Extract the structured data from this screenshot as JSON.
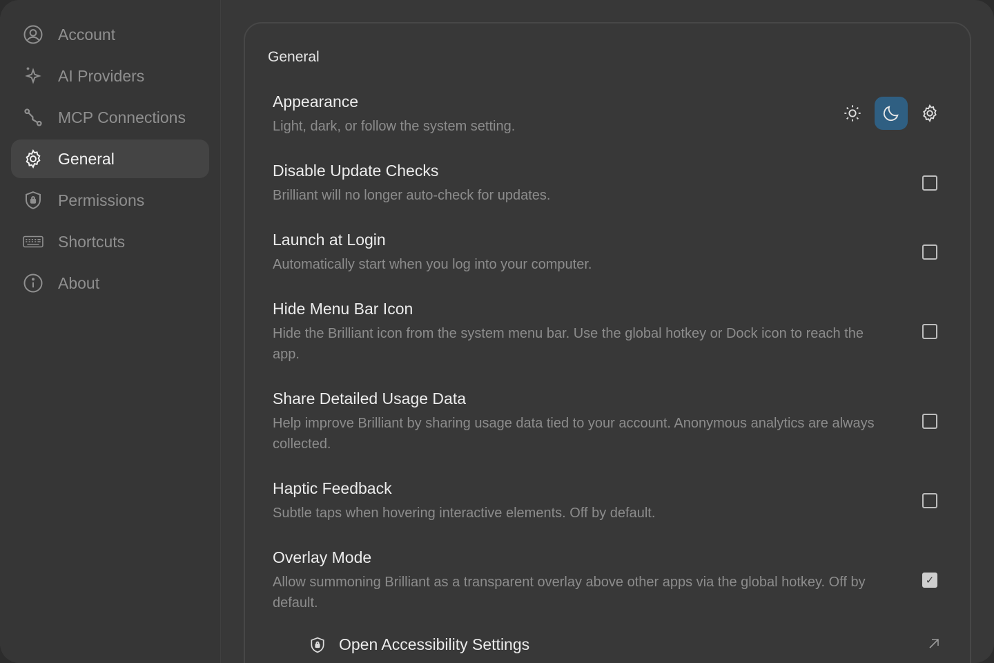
{
  "sidebar": {
    "items": [
      {
        "label": "Account",
        "icon": "account-icon"
      },
      {
        "label": "AI Providers",
        "icon": "sparkle-icon"
      },
      {
        "label": "MCP Connections",
        "icon": "connection-icon"
      },
      {
        "label": "General",
        "icon": "gear-icon",
        "active": true
      },
      {
        "label": "Permissions",
        "icon": "shield-icon"
      },
      {
        "label": "Shortcuts",
        "icon": "keyboard-icon"
      },
      {
        "label": "About",
        "icon": "info-icon"
      }
    ]
  },
  "main": {
    "section_title": "General",
    "appearance": {
      "title": "Appearance",
      "description": "Light, dark, or follow the system setting.",
      "options": [
        "light",
        "dark",
        "system"
      ],
      "selected": "dark",
      "accent": "#2f5f82"
    },
    "settings": [
      {
        "title": "Disable Update Checks",
        "description": "Brilliant will no longer auto-check for updates.",
        "checked": false
      },
      {
        "title": "Launch at Login",
        "description": "Automatically start when you log into your computer.",
        "checked": false
      },
      {
        "title": "Hide Menu Bar Icon",
        "description": "Hide the Brilliant icon from the system menu bar. Use the global hotkey or Dock icon to reach the app.",
        "checked": false
      },
      {
        "title": "Share Detailed Usage Data",
        "description": "Help improve Brilliant by sharing usage data tied to your account. Anonymous analytics are always collected.",
        "checked": false
      },
      {
        "title": "Haptic Feedback",
        "description": "Subtle taps when hovering interactive elements. Off by default.",
        "checked": false
      },
      {
        "title": "Overlay Mode",
        "description": "Allow summoning Brilliant as a transparent overlay above other apps via the global hotkey. Off by default.",
        "checked": true
      }
    ],
    "accessibility_link": "Open Accessibility Settings"
  }
}
